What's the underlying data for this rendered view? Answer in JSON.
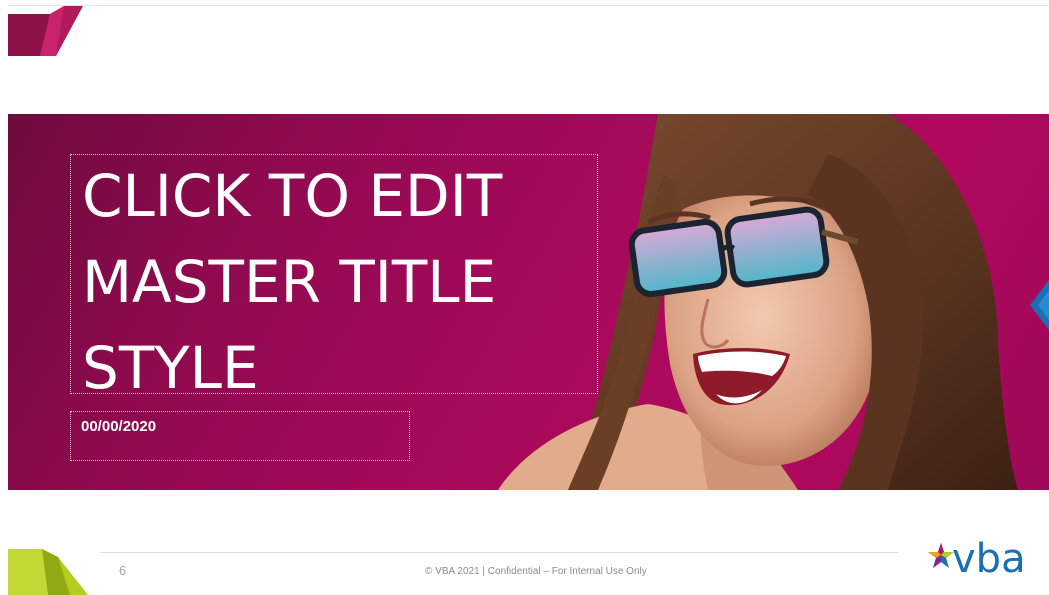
{
  "slide": {
    "title_lines": [
      "CLICK TO EDIT",
      "MASTER TITLE",
      "STYLE"
    ],
    "date_placeholder": "00/00/2020",
    "page_number": "6",
    "footer_text": "© VBA 2021 | Confidential – For Internal Use Only",
    "logo_text": "vba"
  },
  "colors": {
    "hero_magenta": "#a50a5a",
    "accent_crimson": "#b0195a",
    "accent_lime": "#b4cd1e",
    "logo_blue": "#1b6fb3"
  },
  "icons": {
    "corner_top_left": "chevron-shape-magenta",
    "corner_bottom_left": "chevron-shape-lime",
    "logo_star": "multicolor-star-icon",
    "side_marker": "blue-chevron-marker"
  }
}
